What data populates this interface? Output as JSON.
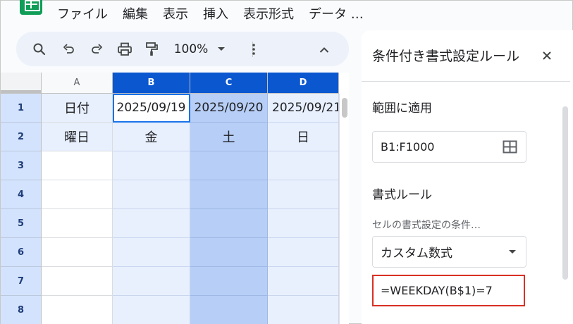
{
  "menu": {
    "items": [
      "ファイル",
      "編集",
      "表示",
      "挿入",
      "表示形式",
      "データ …"
    ]
  },
  "toolbar": {
    "zoom": "100%",
    "icons": [
      "search-icon",
      "undo-icon",
      "redo-icon",
      "print-icon",
      "paint-format-icon",
      "chevron-down-icon",
      "more-vert-icon",
      "chevron-up-icon"
    ]
  },
  "sheet": {
    "columns": [
      "A",
      "B",
      "C",
      "D"
    ],
    "rows": [
      "1",
      "2",
      "3",
      "4",
      "5",
      "6",
      "7",
      "8"
    ],
    "cells": {
      "A1": "日付",
      "B1": "2025/09/19",
      "C1": "2025/09/20",
      "D1": "2025/09/21",
      "A2": "曜日",
      "B2": "金",
      "C2": "土",
      "D2": "日"
    },
    "active_cell": "B1"
  },
  "panel": {
    "title": "条件付き書式設定ルール",
    "range_label": "範囲に適用",
    "range_value": "B1:F1000",
    "rules_label": "書式ルール",
    "condition_label": "セルの書式設定の条件…",
    "condition_value": "カスタム数式",
    "formula_value": "=WEEKDAY(B$1)=7"
  },
  "colors": {
    "selected_header": "#0b57d0",
    "highlight_column": "#b7cef6",
    "selection_tint": "#e8f0fe",
    "formula_border": "#d93025",
    "logo": "#0f9d58"
  }
}
